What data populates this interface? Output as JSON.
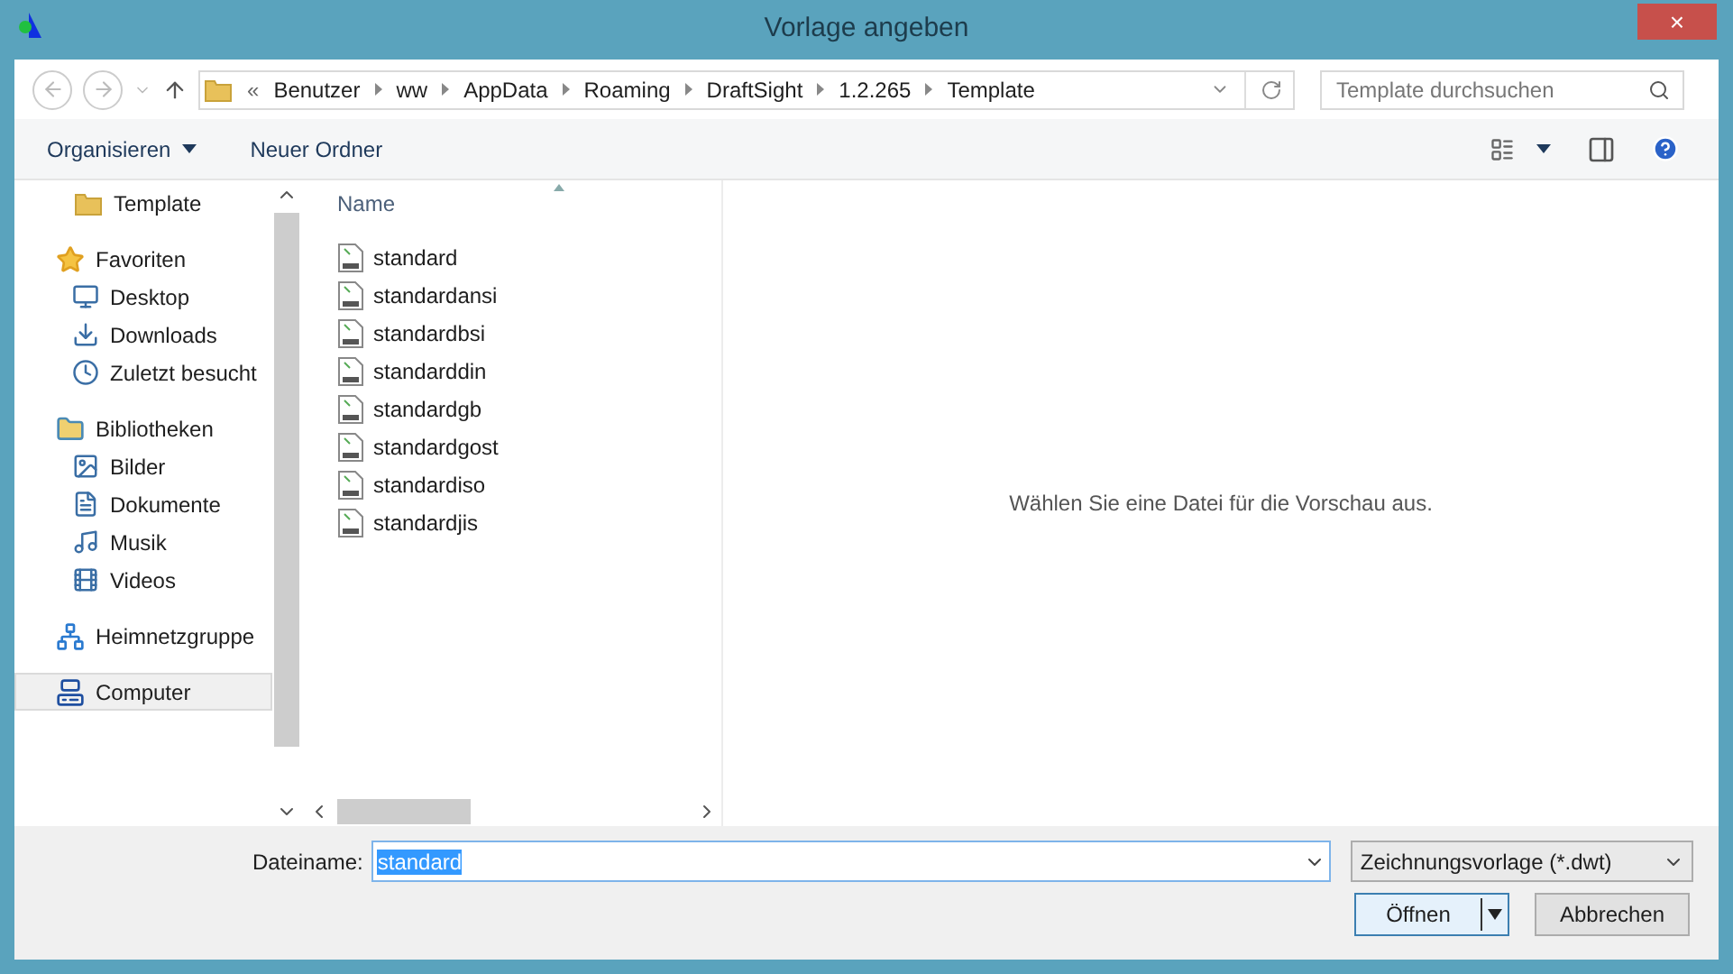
{
  "window": {
    "title": "Vorlage angeben",
    "close": "×"
  },
  "address": {
    "overflow": "«",
    "crumbs": [
      "Benutzer",
      "ww",
      "AppData",
      "Roaming",
      "DraftSight",
      "1.2.265",
      "Template"
    ]
  },
  "search": {
    "placeholder": "Template durchsuchen"
  },
  "toolbar": {
    "organize": "Organisieren",
    "new_folder": "Neuer Ordner"
  },
  "nav": {
    "items": [
      {
        "label": "Template",
        "selected": false
      },
      {
        "label": "Favoriten",
        "selected": false,
        "children": [
          {
            "label": "Desktop",
            "selected": false
          },
          {
            "label": "Downloads",
            "selected": false
          },
          {
            "label": "Zuletzt besucht",
            "selected": false
          }
        ]
      },
      {
        "label": "Bibliotheken",
        "selected": false,
        "children": [
          {
            "label": "Bilder",
            "selected": false
          },
          {
            "label": "Dokumente",
            "selected": false
          },
          {
            "label": "Musik",
            "selected": false
          },
          {
            "label": "Videos",
            "selected": false
          }
        ]
      },
      {
        "label": "Heimnetzgruppe",
        "selected": false
      },
      {
        "label": "Computer",
        "selected": true
      }
    ]
  },
  "files": {
    "column": "Name",
    "items": [
      "standard",
      "standardansi",
      "standardbsi",
      "standarddin",
      "standardgb",
      "standardgost",
      "standardiso",
      "standardjis"
    ]
  },
  "preview": {
    "message": "Wählen Sie eine Datei für die Vorschau aus."
  },
  "footer": {
    "filename_label": "Dateiname:",
    "filename": "standard",
    "filetype": "Zeichnungsvorlage (*.dwt)",
    "open": "Öffnen",
    "cancel": "Abbrechen"
  }
}
